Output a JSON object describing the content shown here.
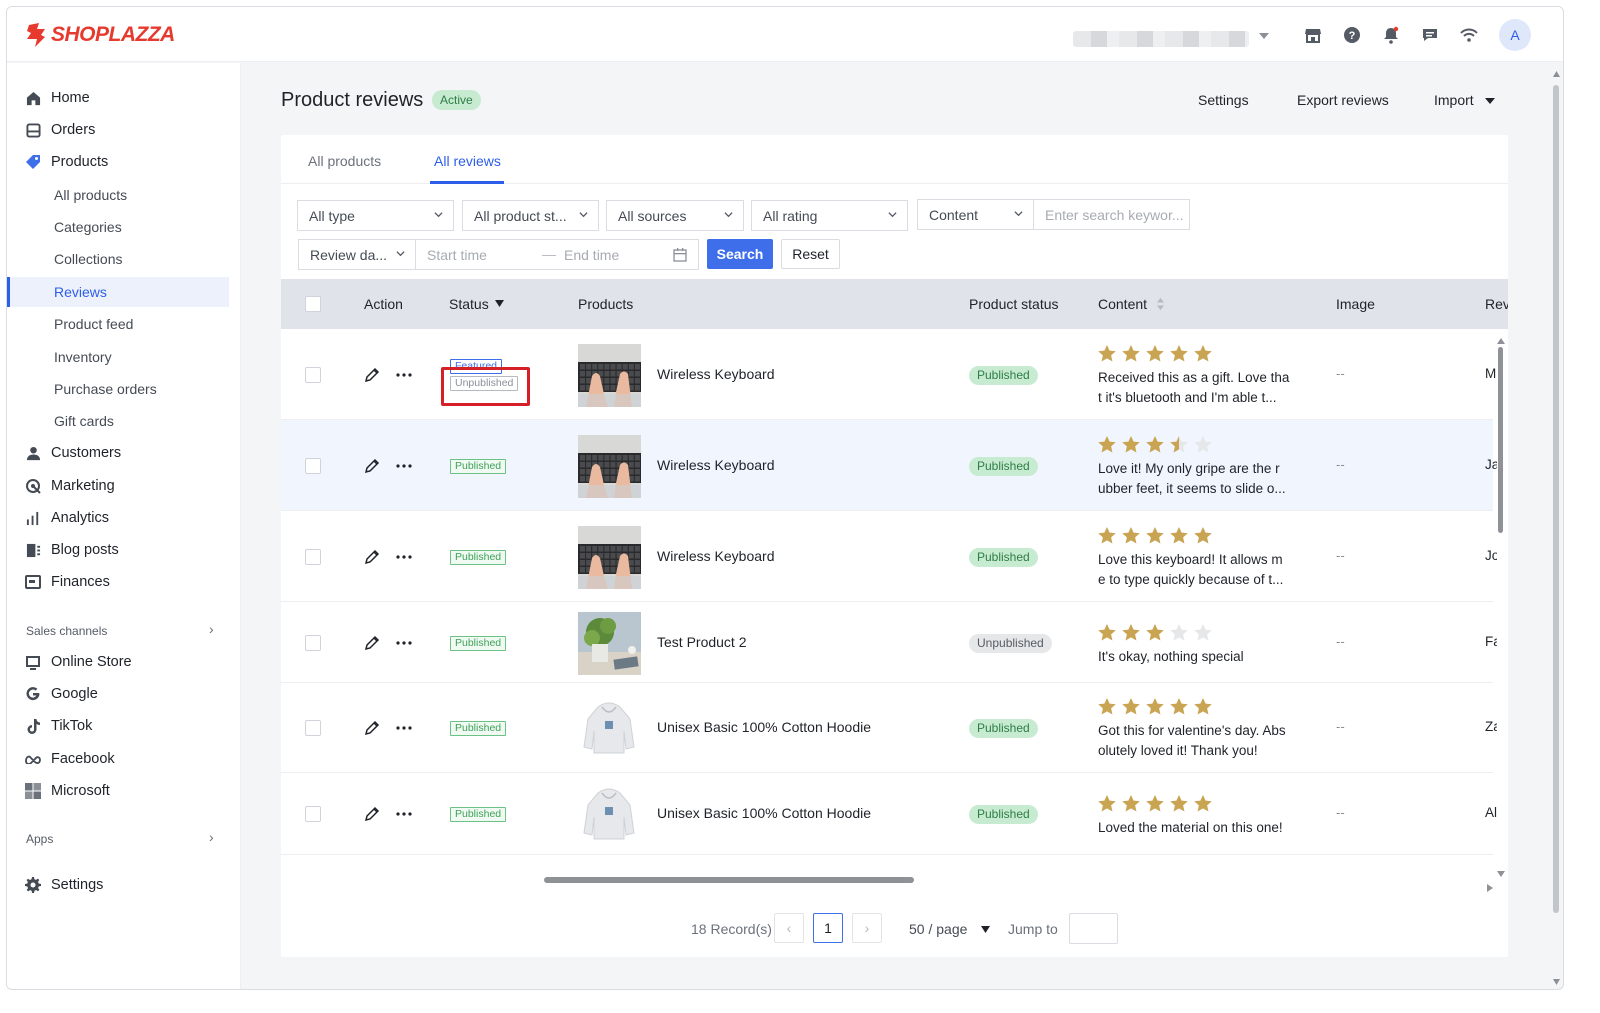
{
  "app": {
    "brand": "SHOPLAZZA",
    "avatar_initial": "A",
    "brand_color": "#e63a2e",
    "accent": "#3e6ee9"
  },
  "sidebar": {
    "items": [
      {
        "label": "Home",
        "icon": "home-icon"
      },
      {
        "label": "Orders",
        "icon": "orders-icon"
      },
      {
        "label": "Products",
        "icon": "tag-icon"
      },
      {
        "label": "Customers",
        "icon": "person-icon"
      },
      {
        "label": "Marketing",
        "icon": "marketing-icon"
      },
      {
        "label": "Analytics",
        "icon": "analytics-icon"
      },
      {
        "label": "Blog posts",
        "icon": "blog-icon"
      },
      {
        "label": "Finances",
        "icon": "finances-icon"
      }
    ],
    "product_subitems": [
      "All products",
      "Categories",
      "Collections",
      "Reviews",
      "Product feed",
      "Inventory",
      "Purchase orders",
      "Gift cards"
    ],
    "sales_channels_label": "Sales channels",
    "channels": [
      {
        "label": "Online Store",
        "icon": "store-icon"
      },
      {
        "label": "Google",
        "icon": "google-icon"
      },
      {
        "label": "TikTok",
        "icon": "tiktok-icon"
      },
      {
        "label": "Facebook",
        "icon": "meta-icon"
      },
      {
        "label": "Microsoft",
        "icon": "microsoft-icon"
      }
    ],
    "apps_label": "Apps",
    "settings_label": "Settings"
  },
  "header": {
    "title": "Product reviews",
    "badge": "Active",
    "settings": "Settings",
    "export": "Export reviews",
    "import": "Import"
  },
  "tabs": [
    "All products",
    "All reviews"
  ],
  "filters": {
    "type": "All type",
    "product_status": "All product st...",
    "sources": "All sources",
    "rating": "All rating",
    "content": "Content",
    "search_placeholder": "Enter search keywor...",
    "review_date": "Review da...",
    "start_placeholder": "Start time",
    "end_placeholder": "End time",
    "search_btn": "Search",
    "reset_btn": "Reset"
  },
  "table": {
    "columns": [
      "Action",
      "Status",
      "Products",
      "Product status",
      "Content",
      "Image",
      "Rev"
    ],
    "rows": [
      {
        "status_tags": [
          "Featured",
          "Unpublished"
        ],
        "product": "Wireless Keyboard",
        "thumb": "keyboard",
        "product_status": "Published",
        "rating": 5,
        "content_l1": "Received this as a gift. Love tha",
        "content_l2": "t it's bluetooth and I'm able t...",
        "image": "--",
        "reviewer": "M"
      },
      {
        "status_tags": [
          "Published"
        ],
        "product": "Wireless Keyboard",
        "thumb": "keyboard",
        "product_status": "Published",
        "rating": 3.5,
        "content_l1": "Love it! My only gripe are the r",
        "content_l2": "ubber feet, it seems to slide o...",
        "image": "--",
        "reviewer": "Ja"
      },
      {
        "status_tags": [
          "Published"
        ],
        "product": "Wireless Keyboard",
        "thumb": "keyboard",
        "product_status": "Published",
        "rating": 5,
        "content_l1": "Love this keyboard! It allows m",
        "content_l2": "e to type quickly because of t...",
        "image": "--",
        "reviewer": "Jo"
      },
      {
        "status_tags": [
          "Published"
        ],
        "product": "Test Product 2",
        "thumb": "plant",
        "product_status": "Unpublished",
        "rating": 3,
        "content_l1": "It's okay, nothing special",
        "content_l2": "",
        "image": "--",
        "reviewer": "Fa"
      },
      {
        "status_tags": [
          "Published"
        ],
        "product": "Unisex Basic 100% Cotton Hoodie",
        "thumb": "hoodie",
        "product_status": "Published",
        "rating": 5,
        "content_l1": "Got this for valentine's day. Abs",
        "content_l2": "olutely loved it! Thank you!",
        "image": "--",
        "reviewer": "Za"
      },
      {
        "status_tags": [
          "Published"
        ],
        "product": "Unisex Basic 100% Cotton Hoodie",
        "thumb": "hoodie",
        "product_status": "Published",
        "rating": 5,
        "content_l1": "Loved the material on this one!",
        "content_l2": "",
        "image": "--",
        "reviewer": "Al"
      }
    ]
  },
  "pagination": {
    "records": "18 Record(s)",
    "current_page": "1",
    "page_size": "50 / page",
    "jump_label": "Jump to"
  }
}
